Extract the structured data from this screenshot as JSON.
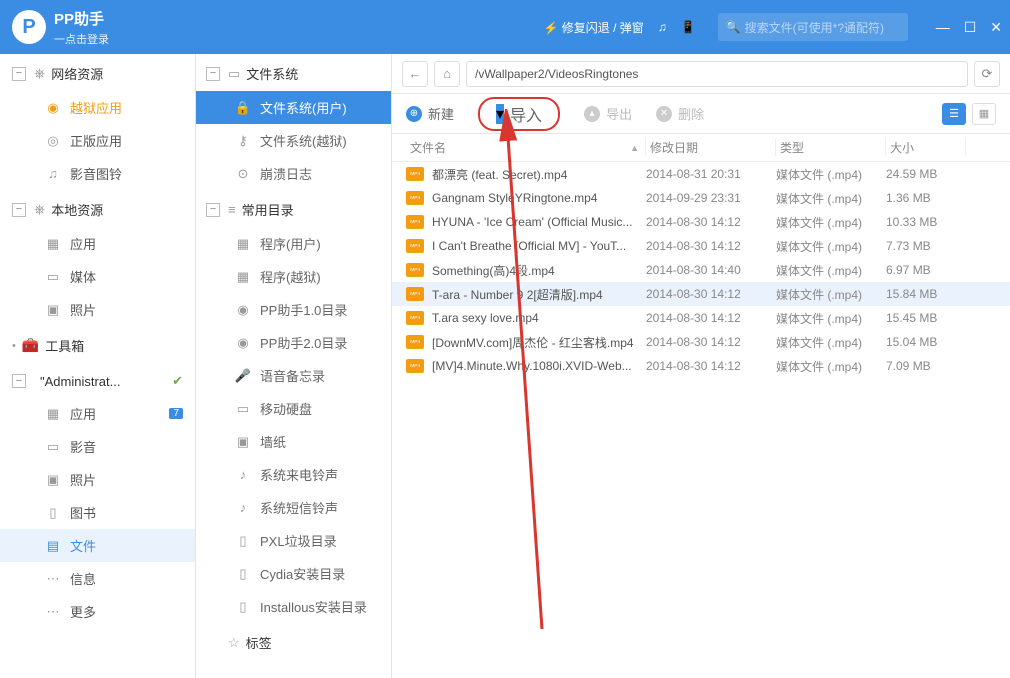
{
  "titlebar": {
    "app_name": "PP助手",
    "subtitle": "一点击登录",
    "repair_text": "修复闪退 / 弹窗",
    "search_placeholder": "搜索文件(可使用*?通配符)"
  },
  "sidebar1": {
    "groups": [
      {
        "label": "网络资源",
        "items": [
          {
            "label": "越狱应用",
            "style": "orange",
            "icon": "◉"
          },
          {
            "label": "正版应用",
            "icon": "◎"
          },
          {
            "label": "影音图铃",
            "icon": "♫"
          }
        ]
      },
      {
        "label": "本地资源",
        "items": [
          {
            "label": "应用",
            "icon": "▦"
          },
          {
            "label": "媒体",
            "icon": "▭"
          },
          {
            "label": "照片",
            "icon": "▣"
          }
        ]
      },
      {
        "label": "工具箱",
        "simple": true
      },
      {
        "label": "\"Administrat...",
        "check": true,
        "items": [
          {
            "label": "应用",
            "icon": "▦",
            "badge": "7"
          },
          {
            "label": "影音",
            "icon": "▭"
          },
          {
            "label": "照片",
            "icon": "▣"
          },
          {
            "label": "图书",
            "icon": "▯"
          },
          {
            "label": "文件",
            "icon": "▤",
            "selected": true
          },
          {
            "label": "信息",
            "icon": "⋯"
          },
          {
            "label": "更多",
            "icon": "⋯"
          }
        ]
      }
    ]
  },
  "sidebar2": {
    "sections": [
      {
        "label": "文件系统",
        "icon": "▭",
        "items": [
          {
            "label": "文件系统(用户)",
            "icon": "🔒",
            "active": true
          },
          {
            "label": "文件系统(越狱)",
            "icon": "⚷"
          },
          {
            "label": "崩溃日志",
            "icon": "⊙"
          }
        ]
      },
      {
        "label": "常用目录",
        "icon": "≡",
        "items": [
          {
            "label": "程序(用户)",
            "icon": "▦"
          },
          {
            "label": "程序(越狱)",
            "icon": "▦"
          },
          {
            "label": "PP助手1.0目录",
            "icon": "◉"
          },
          {
            "label": "PP助手2.0目录",
            "icon": "◉"
          },
          {
            "label": "语音备忘录",
            "icon": "🎤"
          },
          {
            "label": "移动硬盘",
            "icon": "▭"
          },
          {
            "label": "墙纸",
            "icon": "▣"
          },
          {
            "label": "系统来电铃声",
            "icon": "♪"
          },
          {
            "label": "系统短信铃声",
            "icon": "♪"
          },
          {
            "label": "PXL垃圾目录",
            "icon": "▯"
          },
          {
            "label": "Cydia安装目录",
            "icon": "▯"
          },
          {
            "label": "Installous安装目录",
            "icon": "▯"
          }
        ]
      },
      {
        "label": "标签",
        "icon": "☆",
        "leaf": true
      }
    ]
  },
  "pathbar": {
    "path": "/vWallpaper2/VideosRingtones"
  },
  "toolbar": {
    "new": "新建",
    "import": "导入",
    "export": "导出",
    "delete": "删除"
  },
  "columns": {
    "name": "文件名",
    "date": "修改日期",
    "type": "类型",
    "size": "大小"
  },
  "files": [
    {
      "name": "都漂亮 (feat. Secret).mp4",
      "date": "2014-08-31 20:31",
      "type": "媒体文件 (.mp4)",
      "size": "24.59 MB"
    },
    {
      "name": "Gangnam StyleYRingtone.mp4",
      "date": "2014-09-29 23:31",
      "type": "媒体文件 (.mp4)",
      "size": "1.36 MB"
    },
    {
      "name": "HYUNA - 'Ice Cream' (Official Music...",
      "date": "2014-08-30 14:12",
      "type": "媒体文件 (.mp4)",
      "size": "10.33 MB"
    },
    {
      "name": "I Can't Breathe [Official MV] - YouT...",
      "date": "2014-08-30 14:12",
      "type": "媒体文件 (.mp4)",
      "size": "7.73 MB"
    },
    {
      "name": "Something(高)4段.mp4",
      "date": "2014-08-30 14:40",
      "type": "媒体文件 (.mp4)",
      "size": "6.97 MB"
    },
    {
      "name": "T-ara - Number 9 2[超清版].mp4",
      "date": "2014-08-30 14:12",
      "type": "媒体文件 (.mp4)",
      "size": "15.84 MB",
      "selected": true
    },
    {
      "name": "T.ara sexy love.mp4",
      "date": "2014-08-30 14:12",
      "type": "媒体文件 (.mp4)",
      "size": "15.45 MB"
    },
    {
      "name": "[DownMV.com]周杰伦 - 红尘客栈.mp4",
      "date": "2014-08-30 14:12",
      "type": "媒体文件 (.mp4)",
      "size": "15.04 MB"
    },
    {
      "name": "[MV]4.Minute.Why.1080i.XVID-Web...",
      "date": "2014-08-30 14:12",
      "type": "媒体文件 (.mp4)",
      "size": "7.09 MB"
    }
  ]
}
